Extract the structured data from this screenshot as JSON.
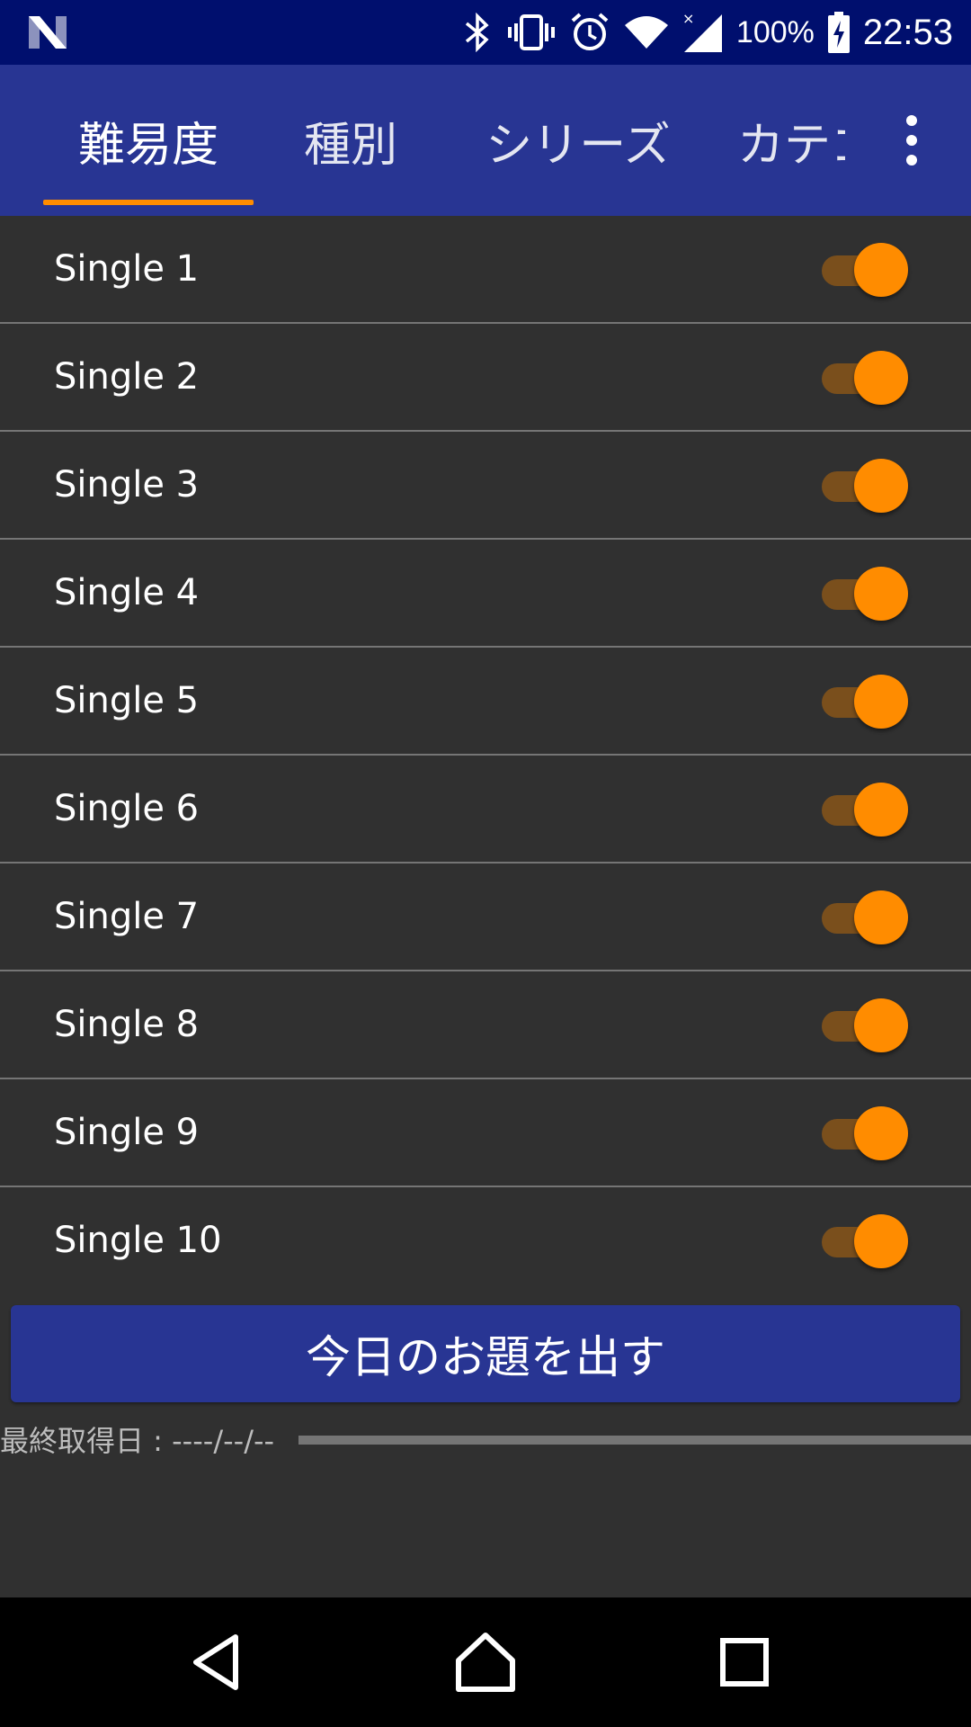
{
  "status_bar": {
    "battery_text": "100%",
    "time": "22:53",
    "icons": [
      "n-logo-icon",
      "bluetooth-icon",
      "vibrate-icon",
      "alarm-icon",
      "wifi-icon",
      "signal-icon",
      "battery-icon"
    ]
  },
  "tabs": [
    {
      "label": "難易度",
      "active": true
    },
    {
      "label": "種別",
      "active": false
    },
    {
      "label": "シリーズ",
      "active": false
    },
    {
      "label": "カテゴ",
      "active": false
    }
  ],
  "list_items": [
    {
      "label": "Single 1",
      "enabled": true
    },
    {
      "label": "Single 2",
      "enabled": true
    },
    {
      "label": "Single 3",
      "enabled": true
    },
    {
      "label": "Single 4",
      "enabled": true
    },
    {
      "label": "Single 5",
      "enabled": true
    },
    {
      "label": "Single 6",
      "enabled": true
    },
    {
      "label": "Single 7",
      "enabled": true
    },
    {
      "label": "Single 8",
      "enabled": true
    },
    {
      "label": "Single 9",
      "enabled": true
    },
    {
      "label": "Single 10",
      "enabled": true
    }
  ],
  "main_button": {
    "label": "今日のお題を出す"
  },
  "last_fetch": {
    "text": "最終取得日 : ----/--/--"
  },
  "colors": {
    "status_bar": "#000f6e",
    "primary": "#283593",
    "accent": "#ff8c00",
    "background": "#303030"
  }
}
